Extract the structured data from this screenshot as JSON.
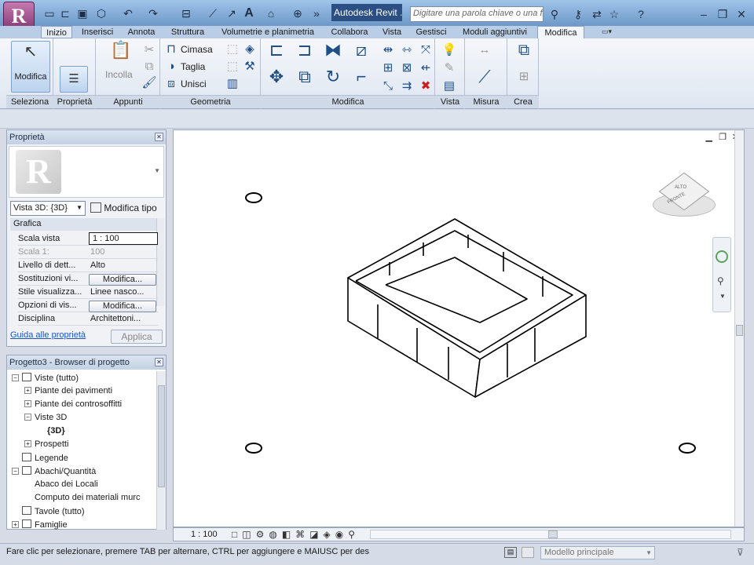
{
  "title_bar": {
    "title": "Autodesk Revit ...",
    "search_placeholder": "Digitare una parola chiave o una fra"
  },
  "tabs": [
    "Inizio",
    "Inserisci",
    "Annota",
    "Struttura",
    "Volumetrie e planimetria",
    "Collabora",
    "Vista",
    "Gestisci",
    "Moduli aggiuntivi",
    "Modifica"
  ],
  "active_tab": "Modifica",
  "ribbon": {
    "modifica_label": "Modifica",
    "incolla_label": "Incolla",
    "cimasa": "Cimasa",
    "taglia": "Taglia",
    "unisci": "Unisci",
    "panels": [
      "Seleziona",
      "Proprietà",
      "Appunti",
      "Geometria",
      "Modifica",
      "Vista",
      "Misura",
      "Crea"
    ]
  },
  "properties": {
    "title": "Proprietà",
    "type_selector": "Vista 3D: {3D}",
    "edit_type": "Modifica tipo",
    "section": "Grafica",
    "rows": [
      {
        "label": "Scala vista",
        "value": "1 : 100"
      },
      {
        "label": "Scala 1:",
        "value": "100"
      },
      {
        "label": "Livello di dett...",
        "value": "Alto"
      },
      {
        "label": "Sostituzioni vi...",
        "value": "Modifica..."
      },
      {
        "label": "Stile visualizza...",
        "value": "Linee nasco..."
      },
      {
        "label": "Opzioni di vis...",
        "value": "Modifica..."
      },
      {
        "label": "Disciplina",
        "value": "Architettoni..."
      }
    ],
    "help_link": "Guida alle proprietà",
    "apply": "Applica"
  },
  "browser": {
    "title": "Progetto3 - Browser di progetto",
    "items": [
      "Viste (tutto)",
      "Piante dei pavimenti",
      "Piante dei controsoffitti",
      "Viste 3D",
      "{3D}",
      "Prospetti",
      "Legende",
      "Abachi/Quantità",
      "Abaco dei Locali",
      "Computo dei materiali murc",
      "Tavole (tutto)",
      "Famiglie"
    ]
  },
  "viewcube": {
    "face_top": "ALTO",
    "face_front": "FRONTE"
  },
  "view_bar": {
    "scale": "1 : 100"
  },
  "status": {
    "hint": "Fare clic per selezionare, premere TAB per alternare, CTRL per aggiungere e MAIUSC per des",
    "model": "Modello principale"
  }
}
